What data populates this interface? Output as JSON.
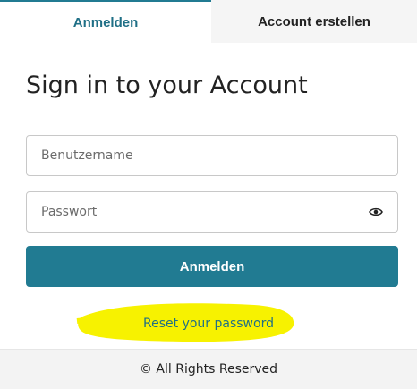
{
  "tabs": {
    "login_label": "Anmelden",
    "register_label": "Account erstellen"
  },
  "title": "Sign in to your Account",
  "form": {
    "username_placeholder": "Benutzername",
    "password_placeholder": "Passwort",
    "submit_label": "Anmelden"
  },
  "reset_link": "Reset your password",
  "footer": "© All Rights Reserved",
  "icons": {
    "password_toggle": "eye-icon"
  },
  "colors": {
    "accent": "#217b92",
    "highlight": "#f7f200"
  }
}
